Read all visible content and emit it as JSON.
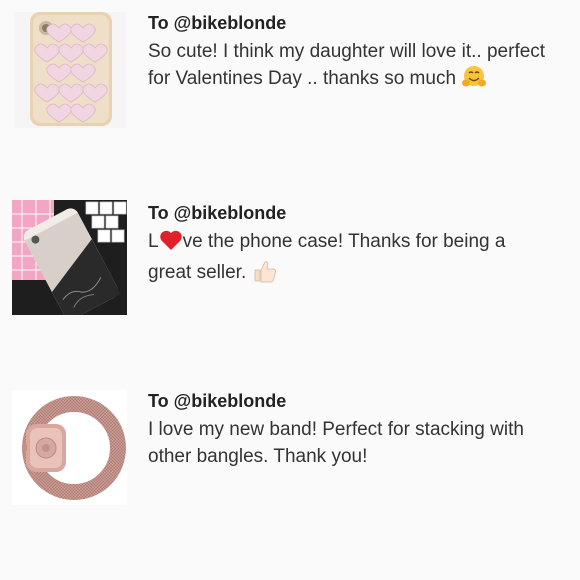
{
  "reviews": [
    {
      "recipient": "To @bikeblonde",
      "line1": "So cute! I think my daughter will love it.. perfect",
      "line2": "for Valentines Day .. thanks so much",
      "emoji": "hugging-face-icon",
      "thumb": "heart-phone-case-image"
    },
    {
      "recipient": "To @bikeblonde",
      "line1_a": "L",
      "line1_b": "ve the phone case! Thanks for being a",
      "line2": "great seller.",
      "emoji": "thumbs-up-icon",
      "thumb": "marble-phone-case-image"
    },
    {
      "recipient": "To @bikeblonde",
      "line1": "I love my new band! Perfect for stacking with",
      "line2": "other bangles. Thank you!",
      "thumb": "milanese-watch-band-image"
    }
  ]
}
